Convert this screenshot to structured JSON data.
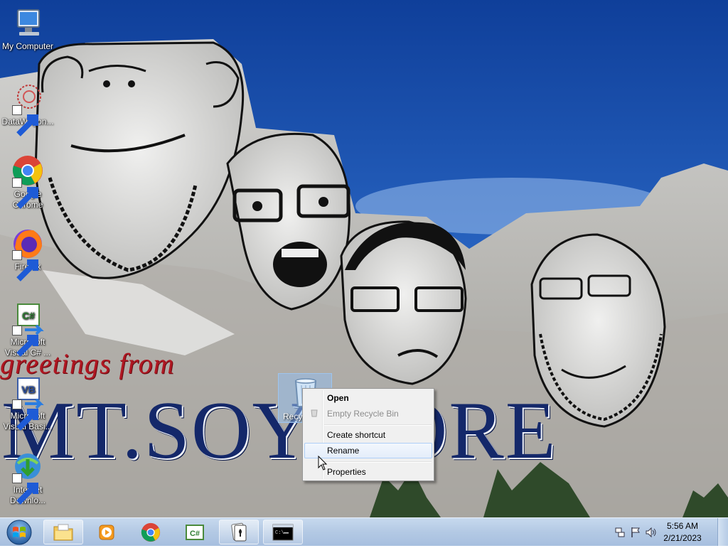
{
  "desktop": {
    "icons": [
      {
        "id": "my-computer",
        "label": "My Computer"
      },
      {
        "id": "datawagon",
        "label": "DataWagon..."
      },
      {
        "id": "google-chrome",
        "label": "Google Chrome"
      },
      {
        "id": "firefox",
        "label": "Firefox"
      },
      {
        "id": "visual-csharp",
        "label": "Microsoft Visual C# ..."
      },
      {
        "id": "visual-basic",
        "label": "Microsoft Visual Basi..."
      },
      {
        "id": "internet-download",
        "label": "Internet Downlo..."
      }
    ],
    "recycle_bin_label": "Recyc"
  },
  "wallpaper": {
    "greeting": "greetings from",
    "place": "MT.SOYMORE"
  },
  "context_menu": {
    "items": [
      {
        "label": "Open",
        "style": "default"
      },
      {
        "label": "Empty Recycle Bin",
        "style": "disabled"
      },
      {
        "label": "Create shortcut",
        "style": "normal"
      },
      {
        "label": "Rename",
        "style": "hover"
      },
      {
        "label": "Properties",
        "style": "normal"
      }
    ]
  },
  "taskbar": {
    "pinned": [
      "start-orb",
      "file-explorer",
      "media-player",
      "chrome",
      "visual-csharp",
      "solitaire",
      "command-prompt"
    ],
    "clock": {
      "time": "5:56 AM",
      "date": "2/21/2023"
    },
    "tray_icons": [
      "network-icon",
      "action-center-flag-icon",
      "speaker-icon"
    ]
  },
  "colors": {
    "sky": "#1d4fa8",
    "greeting_red": "#b01722",
    "title_navy": "#14286a",
    "taskbar": "#b3c9e4"
  }
}
